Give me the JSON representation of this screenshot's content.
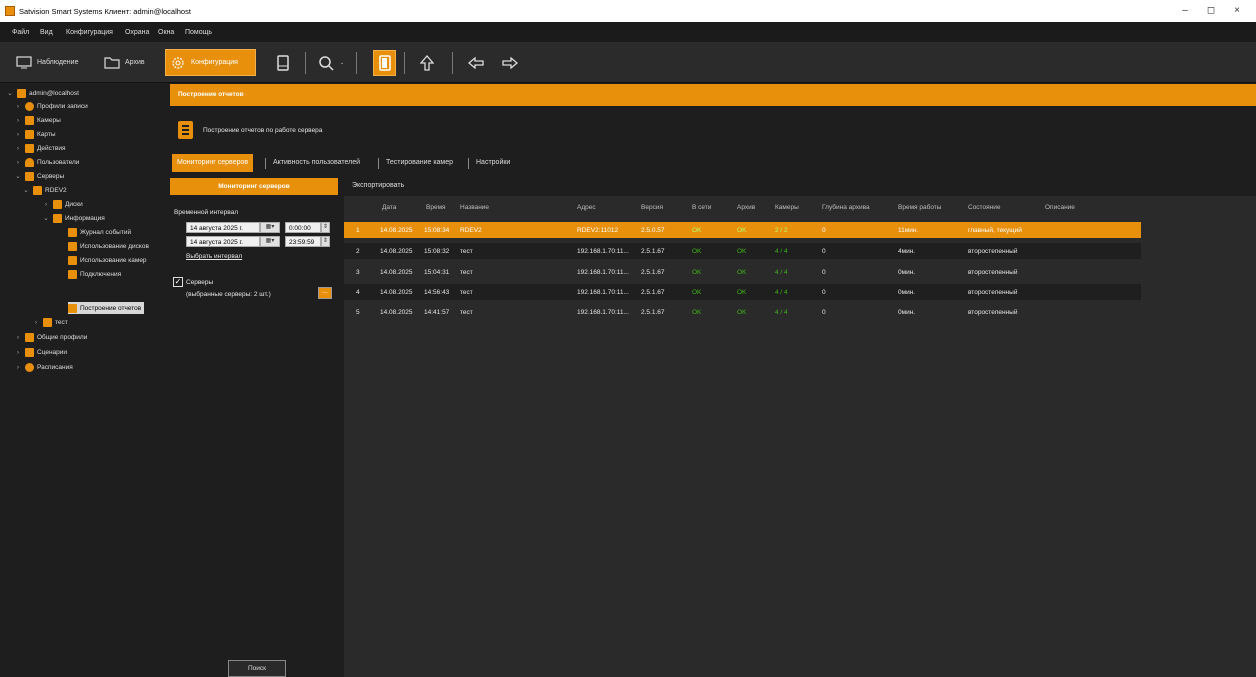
{
  "window": {
    "title": "Satvision Smart Systems Клиент: admin@localhost",
    "controls": [
      "–",
      "◻",
      "×"
    ]
  },
  "menu": [
    "Файл",
    "Вид",
    "Конфигурация",
    "Охрана",
    "Окна",
    "Помощь"
  ],
  "toolbar": {
    "observation": "Наблюдение",
    "archive": "Архив",
    "configuration": "Конфигурация"
  },
  "tree": {
    "root": "admin@localhost",
    "record_profiles": "Профили записи",
    "cameras": "Камеры",
    "maps": "Карты",
    "actions": "Действия",
    "users": "Пользователи",
    "servers": "Серверы",
    "rdev2": "RDEV2",
    "disks": "Диски",
    "info": "Информация",
    "event_log": "Журнал событий",
    "disk_usage": "Использование дисков",
    "camera_usage": "Использование камер",
    "connections": "Подключения",
    "report_building": "Построение отчетов",
    "test": "тест",
    "common_profiles": "Общие профили",
    "scenarios": "Сценарии",
    "schedules": "Расписания"
  },
  "header": {
    "title": "Построение отчетов",
    "subtitle": "Построение отчетов по работе сервера"
  },
  "tabs": [
    "Мониторинг серверов",
    "Активность пользователей",
    "Тестирование камер",
    "Настройки"
  ],
  "filter": {
    "monitor_button": "Мониторинг серверов",
    "interval_label": "Временной интервал",
    "date_from": "14 августа 2025 г.",
    "time_from": "0:00:00",
    "date_to": "14 августа 2025 г.",
    "time_to": "23:59:59",
    "choose_interval": "Выбрать интервал",
    "servers_label": "Серверы",
    "servers_selected": "(выбранные серверы: 2 шт.)",
    "dots": "...",
    "search": "Поиск"
  },
  "export": "Экспортировать",
  "columns": [
    "Дата",
    "Время",
    "Название",
    "Адрес",
    "Версия",
    "В сети",
    "Архив",
    "Камеры",
    "Глубина архива",
    "Время работы",
    "Состояние",
    "Описание"
  ],
  "rows": [
    {
      "n": "1",
      "date": "14.08.2025",
      "time": "15:08:34",
      "name": "RDEV2",
      "addr": "RDEV2:11012",
      "ver": "2.5.0.57",
      "online": "OK",
      "archive": "OK",
      "cams": "2 / 2",
      "depth": "0",
      "uptime": "11мин.",
      "state": "главный, текущий",
      "desc": ""
    },
    {
      "n": "2",
      "date": "14.08.2025",
      "time": "15:08:32",
      "name": "тест",
      "addr": "192.168.1.70:11...",
      "ver": "2.5.1.67",
      "online": "OK",
      "archive": "OK",
      "cams": "4 / 4",
      "depth": "0",
      "uptime": "4мин.",
      "state": "второстепенный",
      "desc": ""
    },
    {
      "n": "3",
      "date": "14.08.2025",
      "time": "15:04:31",
      "name": "тест",
      "addr": "192.168.1.70:11...",
      "ver": "2.5.1.67",
      "online": "OK",
      "archive": "OK",
      "cams": "4 / 4",
      "depth": "0",
      "uptime": "0мин.",
      "state": "второстепенный",
      "desc": ""
    },
    {
      "n": "4",
      "date": "14.08.2025",
      "time": "14:56:43",
      "name": "тест",
      "addr": "192.168.1.70:11...",
      "ver": "2.5.1.67",
      "online": "OK",
      "archive": "OK",
      "cams": "4 / 4",
      "depth": "0",
      "uptime": "0мин.",
      "state": "второстепенный",
      "desc": ""
    },
    {
      "n": "5",
      "date": "14.08.2025",
      "time": "14:41:57",
      "name": "тест",
      "addr": "192.168.1.70:11...",
      "ver": "2.5.1.67",
      "online": "OK",
      "archive": "OK",
      "cams": "4 / 4",
      "depth": "0",
      "uptime": "0мин.",
      "state": "второстепенный",
      "desc": ""
    }
  ],
  "colors": {
    "accent": "#e8900c",
    "ok": "#3fb618",
    "bg": "#1e1e1e"
  }
}
